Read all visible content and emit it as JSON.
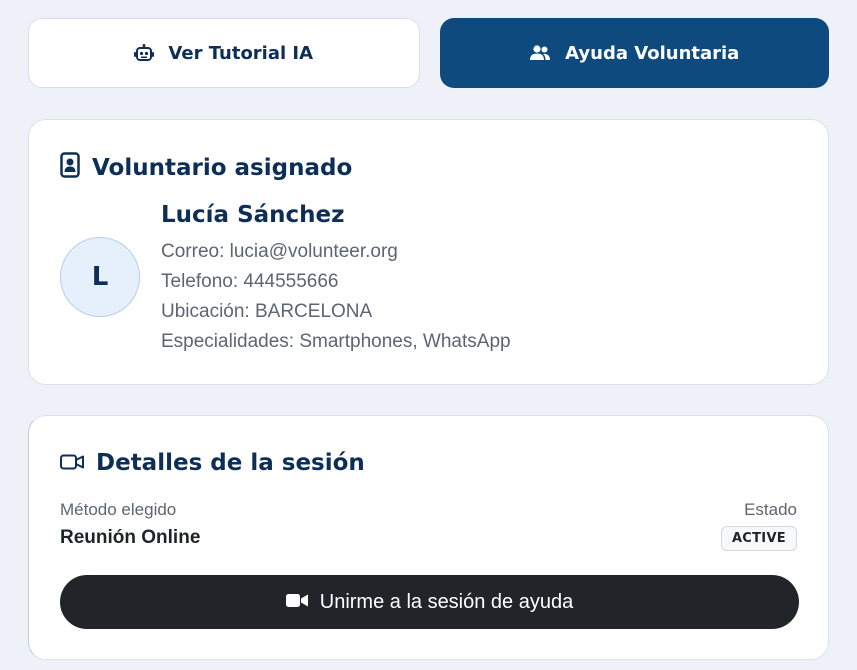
{
  "tabs": {
    "tutorial_label": "Ver Tutorial IA",
    "volunteer_label": "Ayuda Voluntaria"
  },
  "volunteer": {
    "title": "Voluntario asignado",
    "initial": "L",
    "name": "Lucía Sánchez",
    "email": "Correo: lucia@volunteer.org",
    "phone": "Telefono: 444555666",
    "location": "Ubicación: BARCELONA",
    "specialties": "Especialidades: Smartphones, WhatsApp"
  },
  "session": {
    "title": "Detalles de la sesión",
    "method_label": "Método elegido",
    "method_value": "Reunión Online",
    "status_label": "Estado",
    "status_value": "ACTIVE",
    "join_label": "Unirme a la sesión de ayuda"
  },
  "colors": {
    "primary": "#0e4a7e",
    "heading": "#0d2f57",
    "dark_button": "#212529",
    "background": "#eef1f7"
  },
  "icons": {
    "tutorial": "robot-icon",
    "volunteer": "users-icon",
    "badge": "id-badge-icon",
    "session": "video-camera-icon",
    "join": "video-camera-filled-icon"
  }
}
